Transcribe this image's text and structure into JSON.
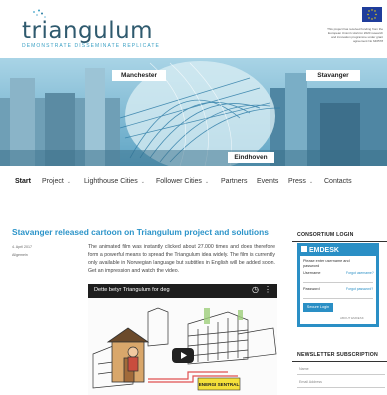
{
  "site": {
    "logo_text": "triangulum",
    "tagline": "DEMONSTRATE DISSEMINATE REPLICATE",
    "eu_notice": "This project has received funding from the European Union's Horizon 2020 research and innovation programme under grant agreement No 646578",
    "flag_icon": "eu-flag-icon"
  },
  "banner": {
    "cities": [
      "Manchester",
      "Stavanger",
      "Eindhoven"
    ]
  },
  "nav": {
    "items": [
      {
        "label": "Start",
        "active": true,
        "dropdown": false
      },
      {
        "label": "Project",
        "active": false,
        "dropdown": true
      },
      {
        "label": "Lighthouse Cities",
        "active": false,
        "dropdown": true
      },
      {
        "label": "Follower Cities",
        "active": false,
        "dropdown": true
      },
      {
        "label": "Partners",
        "active": false,
        "dropdown": false
      },
      {
        "label": "Events",
        "active": false,
        "dropdown": false
      },
      {
        "label": "Press",
        "active": false,
        "dropdown": true
      },
      {
        "label": "Contacts",
        "active": false,
        "dropdown": false
      }
    ]
  },
  "article": {
    "title": "Stavanger released cartoon on Triangulum project and solutions",
    "date": "4. April 2017",
    "category": "Allgemein",
    "body": "The animated film was instantly clicked about 27.000 times and does therefore form a powerful means to spread the Triangulum idea widely. The film is currently only available in Norwegian language but subtitles in English will be added soon. Get an impression and watch the video.",
    "video": {
      "title": "Dette betyr Triangulum for deg",
      "sign_text": "ENERGI SENTRAL"
    }
  },
  "sidebar": {
    "consortium_login": {
      "heading": "CONSORTIUM LOGIN",
      "brand": "EMDESK",
      "instruction": "Please enter username and password",
      "username_label": "Username",
      "forgot_username": "Forgot username?",
      "password_label": "Password",
      "forgot_password": "Forgot password?",
      "secure_login": "Secure Login",
      "footer": "ABOUT EMDESK"
    },
    "newsletter": {
      "heading": "NEWSLETTER SUBSCRIPTION",
      "name_placeholder": "Name",
      "email_placeholder": "Email Address"
    }
  },
  "colors": {
    "accent": "#2c94c9",
    "logo": "#2f5a6e",
    "emdesk_blue": "#2a8fc5"
  }
}
